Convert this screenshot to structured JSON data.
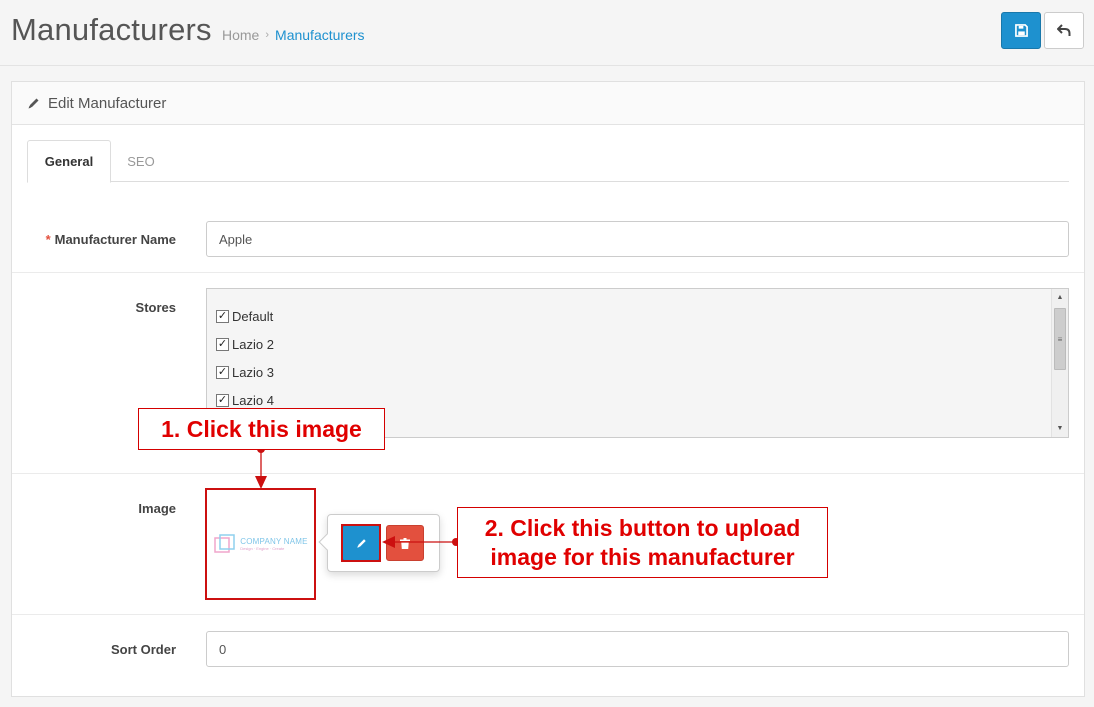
{
  "header": {
    "title": "Manufacturers",
    "breadcrumb": [
      {
        "label": "Home"
      },
      {
        "label": "Manufacturers",
        "active": true
      }
    ]
  },
  "panel": {
    "heading": "Edit Manufacturer",
    "tabs": [
      {
        "label": "General",
        "active": true
      },
      {
        "label": "SEO",
        "active": false
      }
    ]
  },
  "form": {
    "name": {
      "label": "Manufacturer Name",
      "required": true,
      "value": "Apple"
    },
    "stores": {
      "label": "Stores",
      "items": [
        {
          "label": "Default",
          "checked": true
        },
        {
          "label": "Lazio 2",
          "checked": true
        },
        {
          "label": "Lazio 3",
          "checked": true
        },
        {
          "label": "Lazio 4",
          "checked": true
        }
      ]
    },
    "image": {
      "label": "Image",
      "logo_name": "COMPANY NAME",
      "logo_tagline": "Design · Engine · Create"
    },
    "sort_order": {
      "label": "Sort Order",
      "value": "0"
    }
  },
  "annotations": {
    "step1": "1. Click this image",
    "step2_line1": "2. Click this button to upload",
    "step2_line2": "image for this manufacturer"
  },
  "colors": {
    "primary": "#1e91cf",
    "danger": "#e3503e",
    "annotation": "#e00000"
  },
  "icons": {
    "save": "floppy-disk-icon",
    "back": "reply-arrow-icon",
    "heading": "pencil-icon",
    "edit": "pencil-icon",
    "delete": "trash-icon"
  }
}
